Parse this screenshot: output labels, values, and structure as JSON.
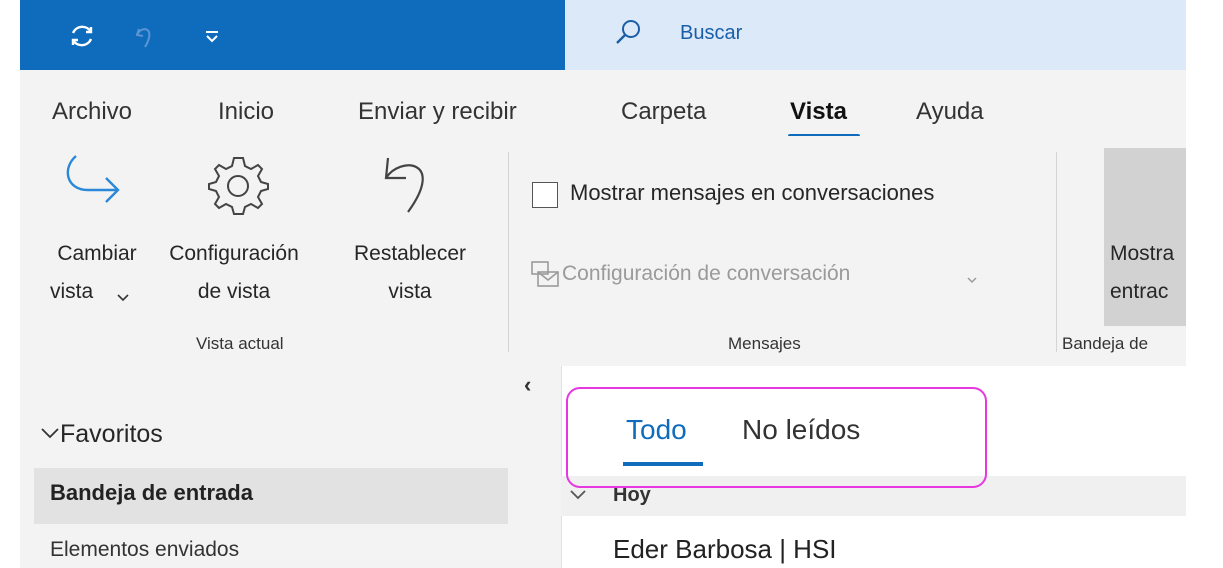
{
  "titlebar": {
    "qat_icons": [
      "sync-icon",
      "undo-icon",
      "customize-qat-icon"
    ],
    "search_placeholder": "Buscar",
    "search_icon": "search-icon"
  },
  "tabs": [
    {
      "label": "Archivo",
      "active": false
    },
    {
      "label": "Inicio",
      "active": false
    },
    {
      "label": "Enviar y recibir",
      "active": false
    },
    {
      "label": "Carpeta",
      "active": false
    },
    {
      "label": "Vista",
      "active": true
    },
    {
      "label": "Ayuda",
      "active": false
    }
  ],
  "ribbon": {
    "vista_actual": {
      "cambiar_vista": {
        "line1": "Cambiar",
        "line2": "vista",
        "icon": "change-view-icon"
      },
      "configuracion_vista": {
        "line1": "Configuración",
        "line2": "de vista",
        "icon": "gear-icon"
      },
      "restablecer_vista": {
        "line1": "Restablecer",
        "line2": "vista",
        "icon": "reset-view-icon"
      },
      "group_label": "Vista actual"
    },
    "mensajes": {
      "show_conversations_label": "Mostrar mensajes en conversaciones",
      "show_conversations_checked": false,
      "conversation_settings_label": "Configuración de conversación",
      "group_label": "Mensajes"
    },
    "bandeja": {
      "button_line1": "Mostra",
      "button_line2": "entrac",
      "group_label": "Bandeja de"
    }
  },
  "leftnav": {
    "collapse_glyph": "‹",
    "favoritos_label": "Favoritos",
    "items": [
      {
        "label": "Bandeja de entrada",
        "selected": true
      },
      {
        "label": "Elementos enviados",
        "selected": false
      }
    ]
  },
  "messagelist": {
    "filters": [
      {
        "label": "Todo",
        "active": true
      },
      {
        "label": "No leídos",
        "active": false
      }
    ],
    "group_header": "Hoy",
    "messages": [
      {
        "sender": "Eder Barbosa | HSI"
      }
    ]
  },
  "colors": {
    "accent": "#0f6cbd",
    "highlight": "#e637e0"
  }
}
